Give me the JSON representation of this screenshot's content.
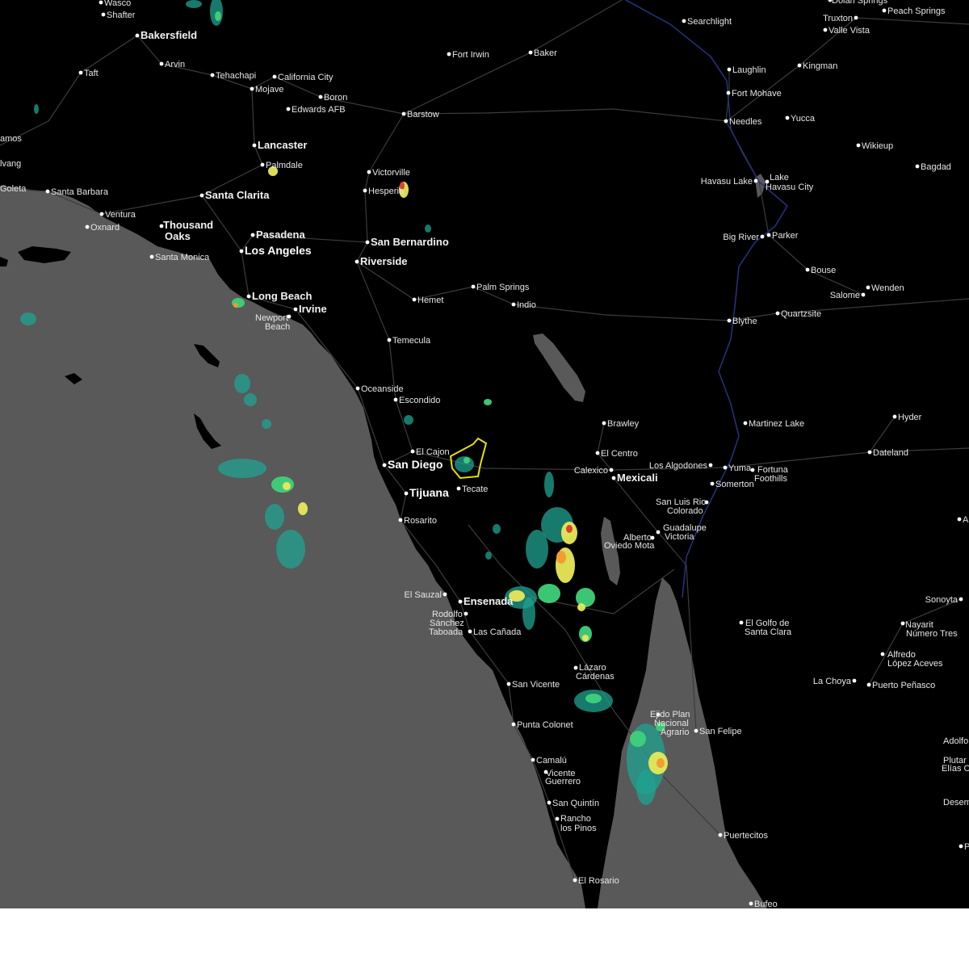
{
  "map": {
    "colors": {
      "land": "#000000",
      "ocean": "#595959",
      "lake": "#595959",
      "roads": "#3c3c3c",
      "river": "#24307a",
      "warning_polygon": "#e8e000",
      "radar_light": "#1fa391",
      "radar_mid": "#3fd17a",
      "radar_high": "#e8e85a",
      "radar_heavy": "#f09a30",
      "radar_extreme": "#d93a2a"
    },
    "places": [
      {
        "id": "wasco",
        "name": "Wasco"
      },
      {
        "id": "shafter",
        "name": "Shafter"
      },
      {
        "id": "bakersfield",
        "name": "Bakersfield"
      },
      {
        "id": "arvin",
        "name": "Arvin"
      },
      {
        "id": "taft",
        "name": "Taft"
      },
      {
        "id": "tehachapi",
        "name": "Tehachapi"
      },
      {
        "id": "california-city",
        "name": "California City"
      },
      {
        "id": "mojave",
        "name": "Mojave"
      },
      {
        "id": "boron",
        "name": "Boron"
      },
      {
        "id": "edwards-afb",
        "name": "Edwards AFB"
      },
      {
        "id": "lancaster",
        "name": "Lancaster"
      },
      {
        "id": "palmdale",
        "name": "Palmdale"
      },
      {
        "id": "lamos",
        "name": "amos"
      },
      {
        "id": "lvang",
        "name": "lvang"
      },
      {
        "id": "goleta",
        "name": "Goleta"
      },
      {
        "id": "santa-barbara",
        "name": "Santa Barbara"
      },
      {
        "id": "ventura",
        "name": "Ventura"
      },
      {
        "id": "oxnard",
        "name": "Oxnard"
      },
      {
        "id": "thousand-oaks",
        "name": "Thousand Oaks"
      },
      {
        "id": "santa-clarita",
        "name": "Santa Clarita"
      },
      {
        "id": "pasadena",
        "name": "Pasadena"
      },
      {
        "id": "los-angeles",
        "name": "Los Angeles"
      },
      {
        "id": "santa-monica",
        "name": "Santa Monica"
      },
      {
        "id": "long-beach",
        "name": "Long Beach"
      },
      {
        "id": "irvine",
        "name": "Irvine"
      },
      {
        "id": "newport-beach",
        "name": "Newport Beach"
      },
      {
        "id": "victorville",
        "name": "Victorville"
      },
      {
        "id": "hesperia",
        "name": "Hesperia"
      },
      {
        "id": "san-bernardino",
        "name": "San Bernardino"
      },
      {
        "id": "riverside",
        "name": "Riverside"
      },
      {
        "id": "barstow",
        "name": "Barstow"
      },
      {
        "id": "fort-irwin",
        "name": "Fort Irwin"
      },
      {
        "id": "baker",
        "name": "Baker"
      },
      {
        "id": "palm-springs",
        "name": "Palm Springs"
      },
      {
        "id": "hemet",
        "name": "Hemet"
      },
      {
        "id": "indio",
        "name": "Indio"
      },
      {
        "id": "temecula",
        "name": "Temecula"
      },
      {
        "id": "oceanside",
        "name": "Oceanside"
      },
      {
        "id": "escondido",
        "name": "Escondido"
      },
      {
        "id": "el-cajon",
        "name": "El Cajon"
      },
      {
        "id": "san-diego",
        "name": "San Diego"
      },
      {
        "id": "tijuana",
        "name": "Tijuana"
      },
      {
        "id": "tecate",
        "name": "Tecate"
      },
      {
        "id": "rosarito",
        "name": "Rosarito"
      },
      {
        "id": "brawley",
        "name": "Brawley"
      },
      {
        "id": "el-centro",
        "name": "El Centro"
      },
      {
        "id": "calexico",
        "name": "Calexico"
      },
      {
        "id": "mexicali",
        "name": "Mexicali"
      },
      {
        "id": "los-algodones",
        "name": "Los Algodones"
      },
      {
        "id": "yuma",
        "name": "Yuma"
      },
      {
        "id": "fortuna-foothills",
        "name": "Fortuna Foothills"
      },
      {
        "id": "somerton",
        "name": "Somerton"
      },
      {
        "id": "san-luis-rio-colorado",
        "name": "San Luis Rio Colorado"
      },
      {
        "id": "alberto-oviedo-mota",
        "name": "Alberto Oviedo Mota"
      },
      {
        "id": "guadalupe-victoria",
        "name": "Guadalupe Victoria"
      },
      {
        "id": "searchlight",
        "name": "Searchlight"
      },
      {
        "id": "laughlin",
        "name": "Laughlin"
      },
      {
        "id": "fort-mohave",
        "name": "Fort Mohave"
      },
      {
        "id": "needles",
        "name": "Needles"
      },
      {
        "id": "kingman",
        "name": "Kingman"
      },
      {
        "id": "yucca",
        "name": "Yucca"
      },
      {
        "id": "truxton",
        "name": "Truxton"
      },
      {
        "id": "valle-vista",
        "name": "Valle Vista"
      },
      {
        "id": "peach-springs",
        "name": "Peach Springs"
      },
      {
        "id": "dolan-springs",
        "name": "Dolan Springs"
      },
      {
        "id": "wikieup",
        "name": "Wikieup"
      },
      {
        "id": "bagdad",
        "name": "Bagdad"
      },
      {
        "id": "havasu-lake",
        "name": "Havasu Lake"
      },
      {
        "id": "lake-havasu-city",
        "name": "Lake Havasu City"
      },
      {
        "id": "big-river",
        "name": "Big River"
      },
      {
        "id": "parker",
        "name": "Parker"
      },
      {
        "id": "bouse",
        "name": "Bouse"
      },
      {
        "id": "salome",
        "name": "Salome"
      },
      {
        "id": "wenden",
        "name": "Wenden"
      },
      {
        "id": "blythe",
        "name": "Blythe"
      },
      {
        "id": "quartzsite",
        "name": "Quartzsite"
      },
      {
        "id": "martinez-lake",
        "name": "Martinez Lake"
      },
      {
        "id": "hyder",
        "name": "Hyder"
      },
      {
        "id": "dateland",
        "name": "Dateland"
      },
      {
        "id": "el-sauzal",
        "name": "El Sauzal"
      },
      {
        "id": "ensenada",
        "name": "Ensenada"
      },
      {
        "id": "rodolfo-sanchez-taboada",
        "name": "Rodolfo Sánchez Taboada"
      },
      {
        "id": "las-canada",
        "name": "Las Cañada"
      },
      {
        "id": "lazaro-cardenas",
        "name": "Lázaro Cárdenas"
      },
      {
        "id": "san-vicente",
        "name": "San Vicente"
      },
      {
        "id": "punta-colonet",
        "name": "Punta Colonet"
      },
      {
        "id": "camalu",
        "name": "Camalú"
      },
      {
        "id": "vicente-guerrero",
        "name": "Vicente Guerrero"
      },
      {
        "id": "san-quintin",
        "name": "San Quintín"
      },
      {
        "id": "rancho-los-pinos",
        "name": "Rancho los Pinos"
      },
      {
        "id": "el-rosario",
        "name": "El Rosario"
      },
      {
        "id": "puertecitos",
        "name": "Puertecitos"
      },
      {
        "id": "bufeo",
        "name": "Bufeo"
      },
      {
        "id": "ejido-plan-nacional-agrario",
        "name": "Ejido Plan Nacional Agrario"
      },
      {
        "id": "san-felipe",
        "name": "San Felipe"
      },
      {
        "id": "el-golfo-de-santa-clara",
        "name": "El Golfo de Santa Clara"
      },
      {
        "id": "sonoyta",
        "name": "Sonoyta"
      },
      {
        "id": "nayarit-numero-tres",
        "name": "Nayarit Número Tres"
      },
      {
        "id": "alfredo-lopez-aceves",
        "name": "Alfredo López Aceves"
      },
      {
        "id": "la-choya",
        "name": "La Choya"
      },
      {
        "id": "puerto-penasco",
        "name": "Puerto Peñasco"
      },
      {
        "id": "elias-calles",
        "name": "Elías Call"
      },
      {
        "id": "adolfo-de-alva",
        "name": "Adolfo de Alv"
      },
      {
        "id": "plutarco",
        "name": "Plutar"
      },
      {
        "id": "desem",
        "name": "Desem"
      },
      {
        "id": "a-edge",
        "name": "A"
      },
      {
        "id": "p-edge",
        "name": "P"
      }
    ]
  }
}
